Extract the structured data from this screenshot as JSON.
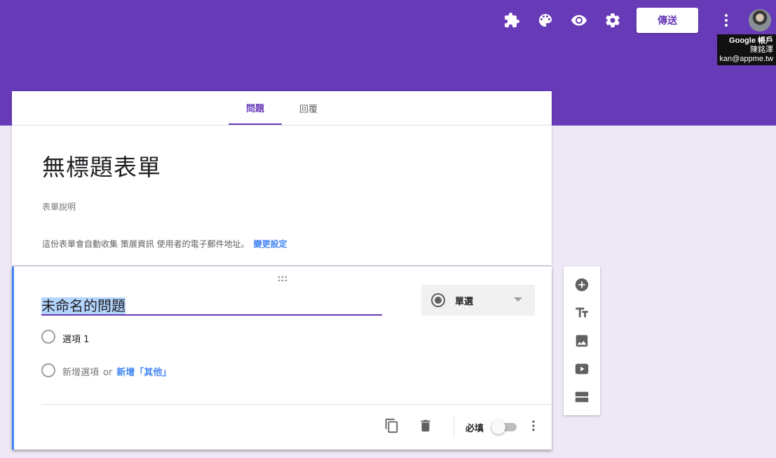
{
  "header": {
    "send_label": "傳送",
    "account_tooltip": {
      "line1": "Google 帳戶",
      "line2": "陳銘澤",
      "line3": "kan@appme.tw"
    },
    "icons": [
      "puzzle-icon",
      "palette-icon",
      "eye-icon",
      "gear-icon",
      "more-vert-icon"
    ]
  },
  "tabs": [
    {
      "label": "問題",
      "active": true
    },
    {
      "label": "回覆",
      "active": false
    }
  ],
  "form": {
    "title": "無標題表單",
    "description_placeholder": "表單說明",
    "notice_text": "這份表單會自動收集 策展資訊 使用者的電子郵件地址。",
    "notice_link": "變更設定"
  },
  "question": {
    "title": "未命名的問題",
    "type_label": "單選",
    "options": [
      "選項 1"
    ],
    "add_option_label": "新增選項",
    "or_label": "or",
    "add_other_label": "新增「其他」",
    "required_label": "必填",
    "required": false
  },
  "side_toolbar": {
    "icons": [
      "add-question-icon",
      "title-text-icon",
      "image-icon",
      "video-icon",
      "section-icon"
    ]
  },
  "colors": {
    "primary": "#673ab7",
    "background": "#ede7f6",
    "accent_blue": "#4285f4"
  }
}
